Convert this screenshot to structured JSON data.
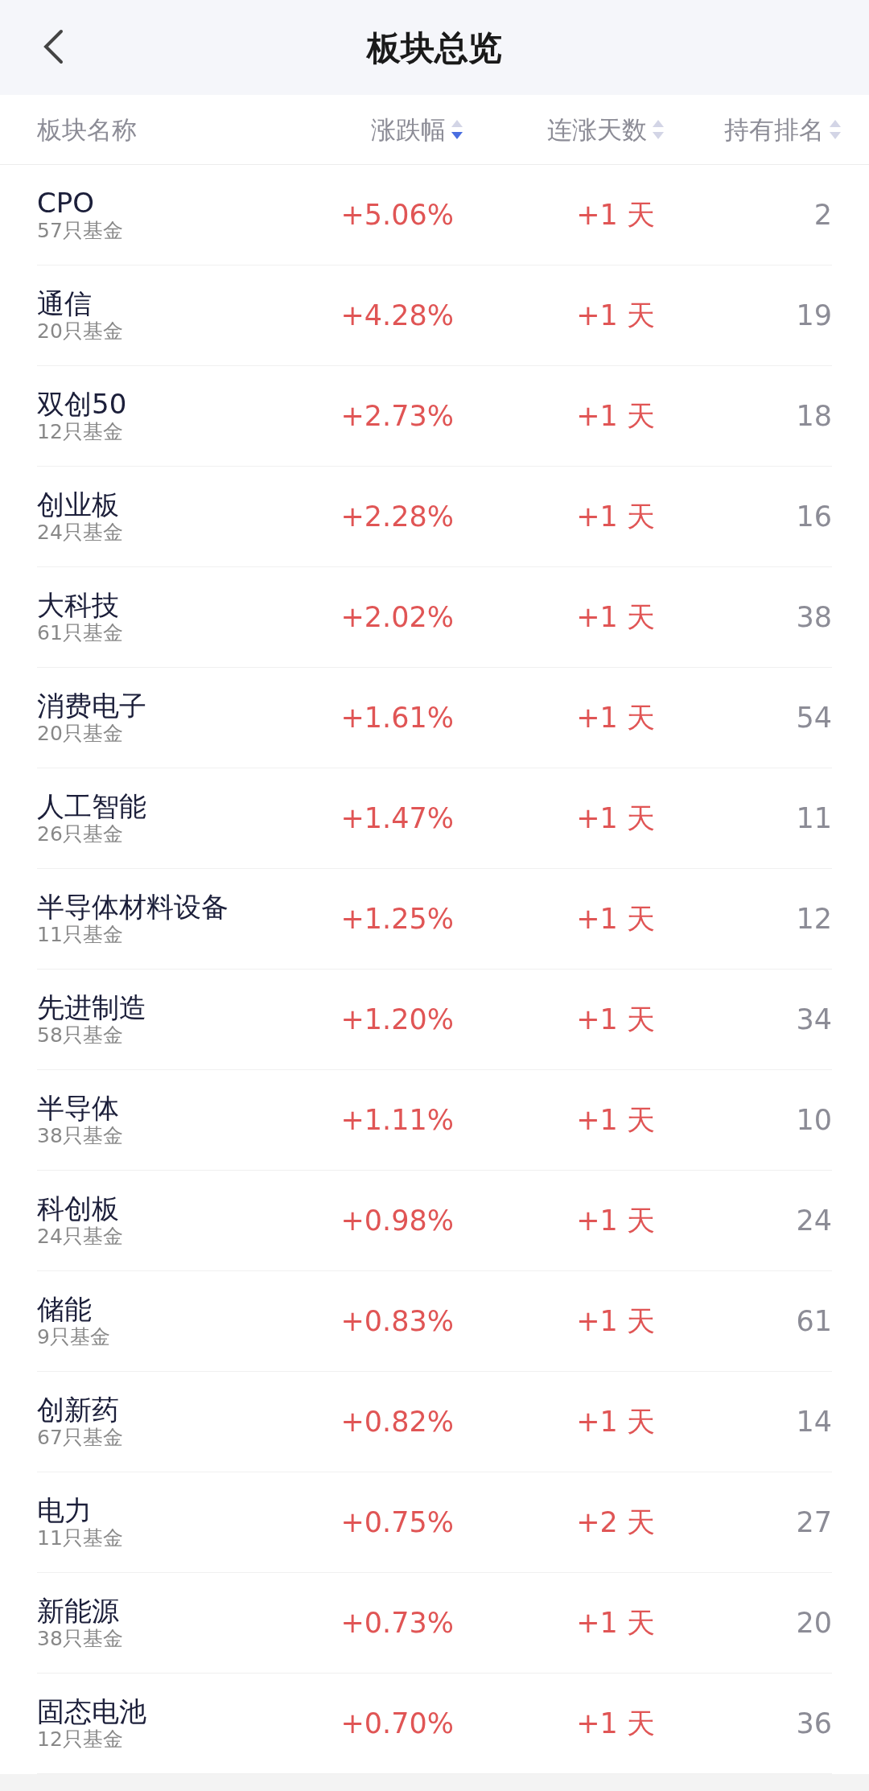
{
  "header": {
    "title": "板块总览"
  },
  "columns": [
    {
      "label": "板块名称"
    },
    {
      "label": "涨跌幅",
      "sorted": true
    },
    {
      "label": "连涨天数",
      "sorted": false
    },
    {
      "label": "持有排名",
      "sorted": false
    }
  ],
  "rows": [
    {
      "name": "CPO",
      "funds": "57只基金",
      "change": "+5.06%",
      "streak": "+1 天",
      "rank": "2"
    },
    {
      "name": "通信",
      "funds": "20只基金",
      "change": "+4.28%",
      "streak": "+1 天",
      "rank": "19"
    },
    {
      "name": "双创50",
      "funds": "12只基金",
      "change": "+2.73%",
      "streak": "+1 天",
      "rank": "18"
    },
    {
      "name": "创业板",
      "funds": "24只基金",
      "change": "+2.28%",
      "streak": "+1 天",
      "rank": "16"
    },
    {
      "name": "大科技",
      "funds": "61只基金",
      "change": "+2.02%",
      "streak": "+1 天",
      "rank": "38"
    },
    {
      "name": "消费电子",
      "funds": "20只基金",
      "change": "+1.61%",
      "streak": "+1 天",
      "rank": "54"
    },
    {
      "name": "人工智能",
      "funds": "26只基金",
      "change": "+1.47%",
      "streak": "+1 天",
      "rank": "11"
    },
    {
      "name": "半导体材料设备",
      "funds": "11只基金",
      "change": "+1.25%",
      "streak": "+1 天",
      "rank": "12"
    },
    {
      "name": "先进制造",
      "funds": "58只基金",
      "change": "+1.20%",
      "streak": "+1 天",
      "rank": "34"
    },
    {
      "name": "半导体",
      "funds": "38只基金",
      "change": "+1.11%",
      "streak": "+1 天",
      "rank": "10"
    },
    {
      "name": "科创板",
      "funds": "24只基金",
      "change": "+0.98%",
      "streak": "+1 天",
      "rank": "24"
    },
    {
      "name": "储能",
      "funds": "9只基金",
      "change": "+0.83%",
      "streak": "+1 天",
      "rank": "61"
    },
    {
      "name": "创新药",
      "funds": "67只基金",
      "change": "+0.82%",
      "streak": "+1 天",
      "rank": "14"
    },
    {
      "name": "电力",
      "funds": "11只基金",
      "change": "+0.75%",
      "streak": "+2 天",
      "rank": "27"
    },
    {
      "name": "新能源",
      "funds": "38只基金",
      "change": "+0.73%",
      "streak": "+1 天",
      "rank": "20"
    },
    {
      "name": "固态电池",
      "funds": "12只基金",
      "change": "+0.70%",
      "streak": "+1 天",
      "rank": "36"
    }
  ]
}
